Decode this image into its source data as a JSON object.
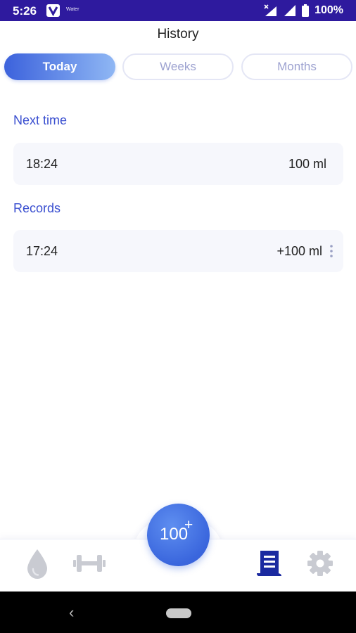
{
  "status_bar": {
    "time": "5:26",
    "app_name": "Water",
    "battery": "100%",
    "icons": [
      "app-v-icon",
      "signal-x-icon",
      "signal-icon",
      "battery-icon"
    ]
  },
  "header": {
    "title": "History"
  },
  "tabs": [
    {
      "label": "Today",
      "active": true
    },
    {
      "label": "Weeks",
      "active": false
    },
    {
      "label": "Months",
      "active": false
    }
  ],
  "next_time": {
    "title": "Next time",
    "time": "18:24",
    "amount": "100 ml"
  },
  "records": {
    "title": "Records",
    "items": [
      {
        "time": "17:24",
        "amount": "+100 ml"
      }
    ]
  },
  "bottom_nav": {
    "items": [
      "water-drop-icon",
      "dumbbell-icon",
      "history-icon",
      "settings-gear-icon"
    ],
    "add_button": {
      "value": "100",
      "symbol": "+"
    }
  },
  "colors": {
    "status_bar": "#2e1a9e",
    "accent": "#3a4fd0",
    "tab_gradient_start": "#3c62dc",
    "tab_gradient_end": "#8fb7f4",
    "active_nav": "#1b2aa0",
    "inactive_nav": "#c9cbd2"
  }
}
